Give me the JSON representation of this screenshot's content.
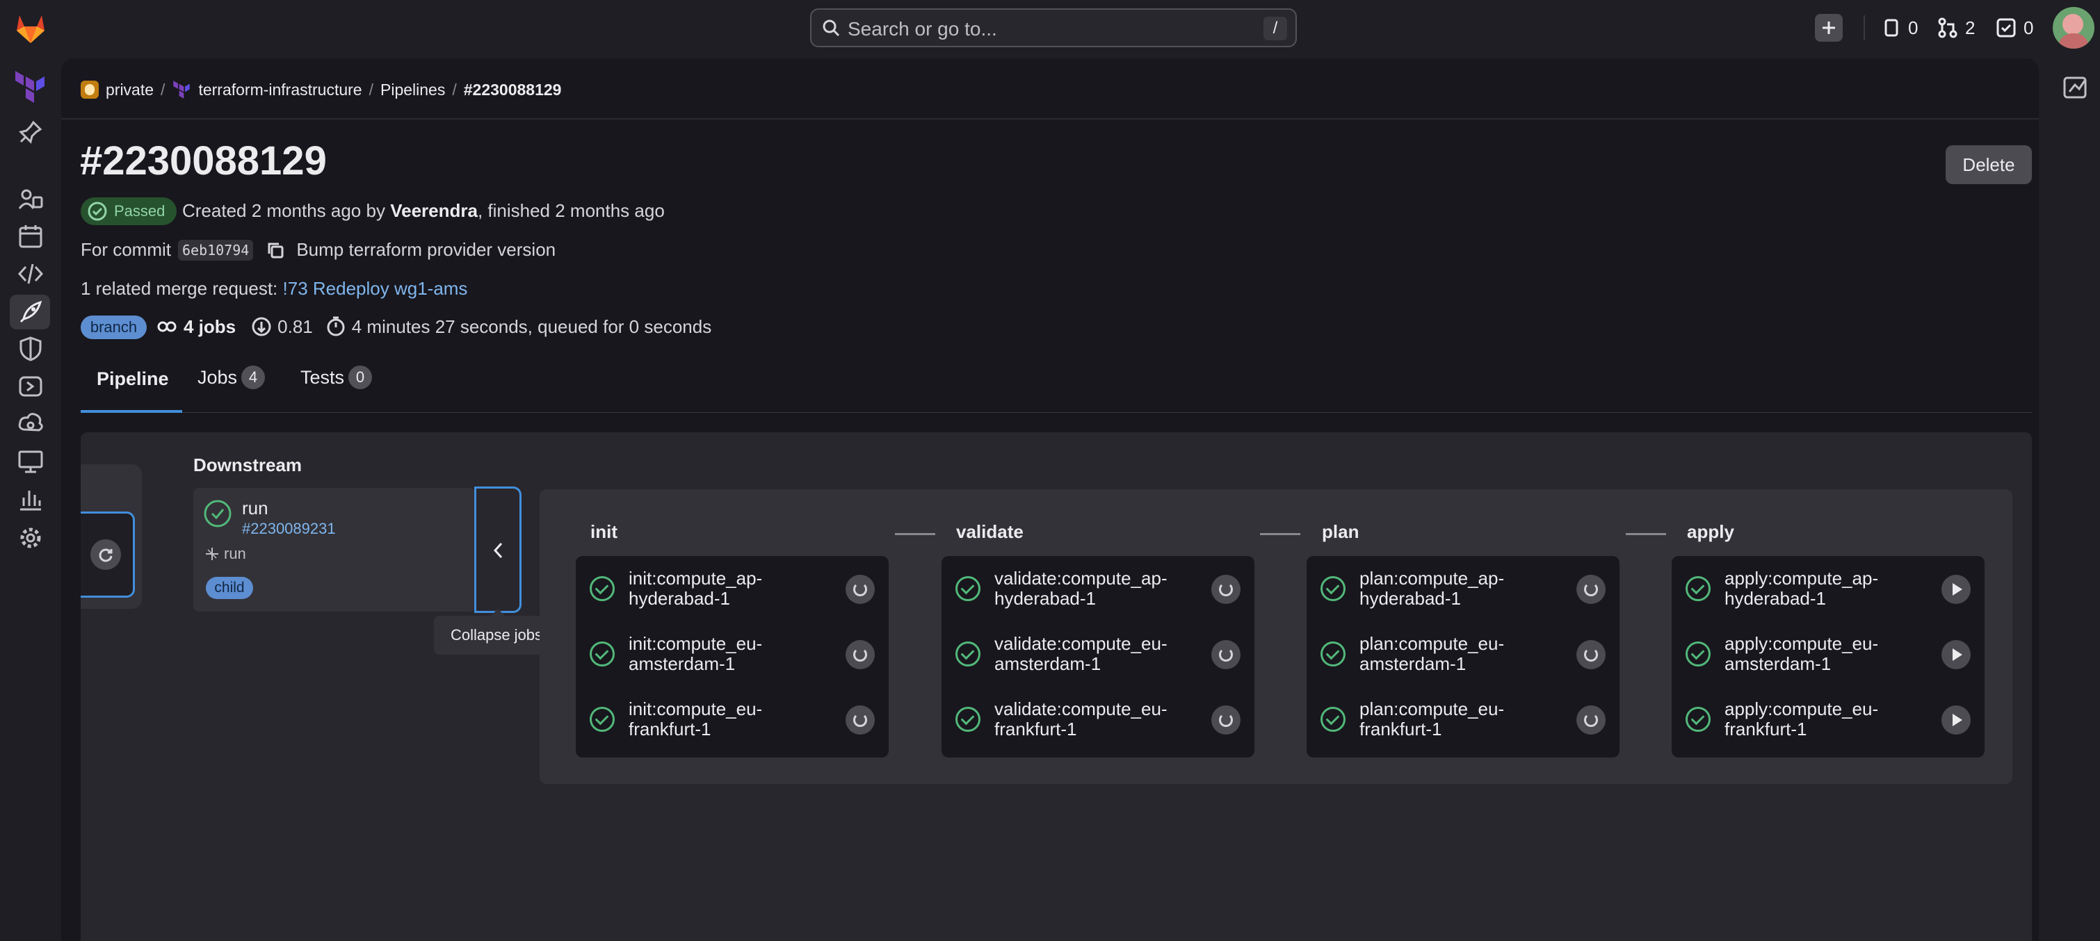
{
  "topbar": {
    "search_placeholder": "Search or go to...",
    "search_shortcut": "/",
    "issues_count": "0",
    "merge_requests_count": "2",
    "todos_count": "0"
  },
  "breadcrumb": {
    "items": [
      "private",
      "terraform-infrastructure",
      "Pipelines",
      "#2230088129"
    ]
  },
  "pipeline": {
    "title": "#2230088129",
    "delete_label": "Delete",
    "status": "Passed",
    "created_prefix": "Created 2 months ago by",
    "author": "Veerendra",
    "finished_suffix": ", finished 2 months ago",
    "commit_prefix": "For commit",
    "commit_sha": "6eb10794",
    "commit_message": "Bump terraform provider version",
    "mr_prefix": "1 related merge request:",
    "mr_link": "!73 Redeploy wg1-ams",
    "ref_badge": "branch",
    "jobs_count": "4 jobs",
    "coverage": "0.81",
    "duration": "4 minutes 27 seconds, queued for 0 seconds"
  },
  "tabs": [
    {
      "label": "Pipeline"
    },
    {
      "label": "Jobs",
      "count": "4"
    },
    {
      "label": "Tests",
      "count": "0"
    }
  ],
  "downstream": {
    "title": "Downstream",
    "card": {
      "name": "run",
      "pipeline_id": "#2230089231",
      "source_label": "run",
      "badge": "child"
    },
    "collapse_tooltip": "Collapse jobs"
  },
  "stages": [
    {
      "name": "init",
      "jobs": [
        {
          "line1": "init:compute_ap-",
          "line2": "hyderabad-1",
          "action": "retry"
        },
        {
          "line1": "init:compute_eu-",
          "line2": "amsterdam-1",
          "action": "retry"
        },
        {
          "line1": "init:compute_eu-",
          "line2": "frankfurt-1",
          "action": "retry"
        }
      ]
    },
    {
      "name": "validate",
      "jobs": [
        {
          "line1": "validate:compute_ap-",
          "line2": "hyderabad-1",
          "action": "retry"
        },
        {
          "line1": "validate:compute_eu-",
          "line2": "amsterdam-1",
          "action": "retry"
        },
        {
          "line1": "validate:compute_eu-",
          "line2": "frankfurt-1",
          "action": "retry"
        }
      ]
    },
    {
      "name": "plan",
      "jobs": [
        {
          "line1": "plan:compute_ap-",
          "line2": "hyderabad-1",
          "action": "retry"
        },
        {
          "line1": "plan:compute_eu-",
          "line2": "amsterdam-1",
          "action": "retry"
        },
        {
          "line1": "plan:compute_eu-",
          "line2": "frankfurt-1",
          "action": "retry"
        }
      ]
    },
    {
      "name": "apply",
      "jobs": [
        {
          "line1": "apply:compute_ap-",
          "line2": "hyderabad-1",
          "action": "play"
        },
        {
          "line1": "apply:compute_eu-",
          "line2": "amsterdam-1",
          "action": "play"
        },
        {
          "line1": "apply:compute_eu-",
          "line2": "frankfurt-1",
          "action": "play"
        }
      ]
    }
  ],
  "colors": {
    "success": "#52b87a",
    "accent": "#428fdc",
    "link": "#7fb6ed",
    "badge_blue": "#5d8ed1"
  },
  "icons": [
    "gitlab-logo-icon",
    "terraform-project-icon",
    "pin-icon",
    "search-icon",
    "plus-icon",
    "issues-icon",
    "merge-request-icon",
    "todo-icon",
    "avatar",
    "copy-icon",
    "job-icon",
    "coverage-icon",
    "clock-icon",
    "retry-icon",
    "play-icon",
    "chevron-left-icon"
  ]
}
